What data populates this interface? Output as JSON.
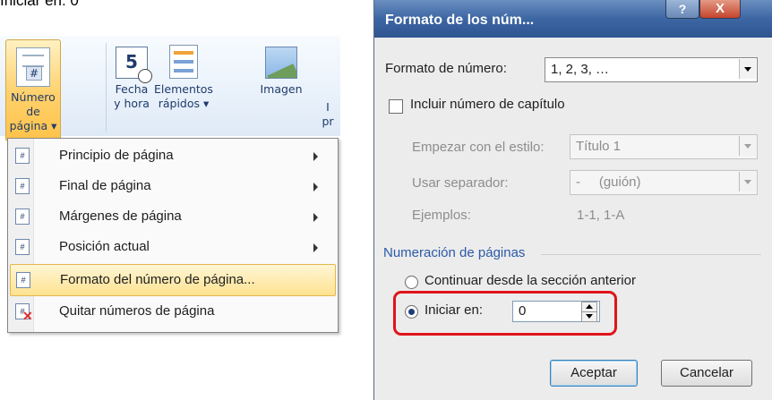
{
  "caption": "Iniciar en: 0",
  "ribbon": {
    "page_number": {
      "line1": "Número de",
      "line2": "página ▾"
    },
    "date_time": {
      "line1": "Fecha",
      "line2": "y hora"
    },
    "quick_parts": {
      "line1": "Elementos",
      "line2": "rápidos ▾"
    },
    "image": {
      "line1": "Imagen"
    },
    "partial_label": {
      "line1": "I",
      "line2": "pr"
    }
  },
  "menu": {
    "items": [
      {
        "label": "Principio de página",
        "has_submenu": true
      },
      {
        "label": "Final de página",
        "has_submenu": true
      },
      {
        "label": "Márgenes de página",
        "has_submenu": true
      },
      {
        "label": "Posición actual",
        "has_submenu": true
      },
      {
        "label": "Formato del número de página...",
        "highlighted": true
      },
      {
        "label": "Quitar números de página"
      }
    ]
  },
  "dialog": {
    "title": "Formato de los núm...",
    "help_label": "?",
    "close_label": "X",
    "number_format_label": "Formato de número:",
    "number_format_value": "1, 2, 3, …",
    "include_chapter_label": "Incluir número de capítulo",
    "start_style_label": "Empezar con el estilo:",
    "start_style_value": "Título 1",
    "separator_label": "Usar separador:",
    "separator_value": "-     (guión)",
    "examples_label": "Ejemplos:",
    "examples_value": "1-1, 1-A",
    "page_numbering_title": "Numeración de páginas",
    "continue_label": "Continuar desde la sección anterior",
    "start_at_label": "Iniciar en:",
    "start_at_value": "0",
    "ok_label": "Aceptar",
    "cancel_label": "Cancelar"
  },
  "colors": {
    "highlight": "#e0141b",
    "accent_title": "#2b5aa8"
  }
}
